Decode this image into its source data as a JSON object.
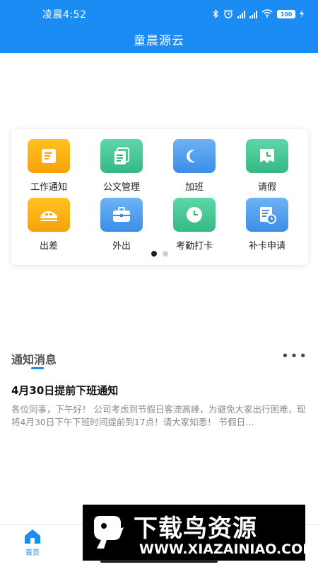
{
  "status_bar": {
    "time": "凌晨4:52",
    "battery": "100",
    "icons": [
      "bluetooth-icon",
      "alarm-icon",
      "hd-signal-icon",
      "hd-signal-icon",
      "wifi-icon",
      "battery-icon",
      "charging-icon"
    ]
  },
  "header": {
    "title": "童晨源云"
  },
  "grid": {
    "items": [
      {
        "label": "工作通知",
        "icon": "document-icon",
        "color": "#f7a10a"
      },
      {
        "label": "公文管理",
        "icon": "files-icon",
        "color": "#34b985"
      },
      {
        "label": "加班",
        "icon": "moon-icon",
        "color": "#3a8ee8"
      },
      {
        "label": "请假",
        "icon": "calendar-clock-icon",
        "color": "#34b985"
      },
      {
        "label": "出差",
        "icon": "train-icon",
        "color": "#f7a10a"
      },
      {
        "label": "外出",
        "icon": "briefcase-icon",
        "color": "#3a8ee8"
      },
      {
        "label": "考勤打卡",
        "icon": "clock-icon",
        "color": "#34b985"
      },
      {
        "label": "补卡申请",
        "icon": "form-clock-icon",
        "color": "#3a8ee8"
      }
    ],
    "page_count": 2,
    "active_page": 1
  },
  "notices": {
    "section_title": "通知消息",
    "more_label": "•••",
    "items": [
      {
        "title": "4月30日提前下班通知",
        "body": "各位同事，下午好！ 公司考虑到节假日客流高峰，为避免大家出行困难，现将4月30日下午下班时间提前到17点！请大家知悉！ 节假日…"
      }
    ]
  },
  "bottom_nav": {
    "home_label": "首页"
  },
  "watermark": {
    "big_text": "下载鸟资源",
    "url": "WWW.XIAZAINIAO.COM"
  },
  "colors": {
    "primary": "#1a8cf3",
    "orange": "#f7a10a",
    "green": "#34b985",
    "blue": "#3a8ee8"
  }
}
